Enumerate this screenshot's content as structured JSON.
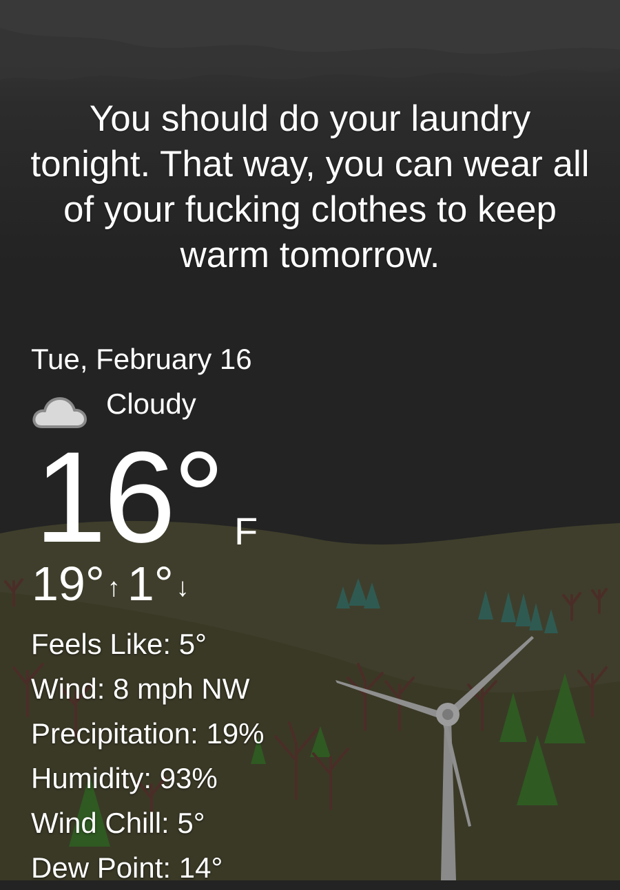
{
  "message": "You should do your laundry tonight. That way, you can wear all of your fucking clothes to keep warm tomorrow.",
  "date": "Tue, February 16",
  "condition": {
    "text": "Cloudy",
    "icon": "cloud-icon"
  },
  "temperature": {
    "value": "16°",
    "unit": "F"
  },
  "high_low": {
    "high": "19°",
    "high_arrow": "↑",
    "low": "1°",
    "low_arrow": "↓"
  },
  "details": [
    "Feels Like: 5°",
    "Wind: 8 mph NW",
    "Precipitation: 19%",
    "Humidity: 93%",
    "Wind Chill: 5°",
    "Dew Point: 14°"
  ],
  "colors": {
    "sky": "#232323",
    "cloud_band": "#3a3a3a",
    "hill_back": "#3f3e2c",
    "hill_front": "#3b3a27",
    "tree_teal": "#2f5a52",
    "tree_green": "#2f5a22",
    "bare_tree": "#4a2c26",
    "turbine": "#8f8f8f",
    "text": "#ffffff"
  }
}
